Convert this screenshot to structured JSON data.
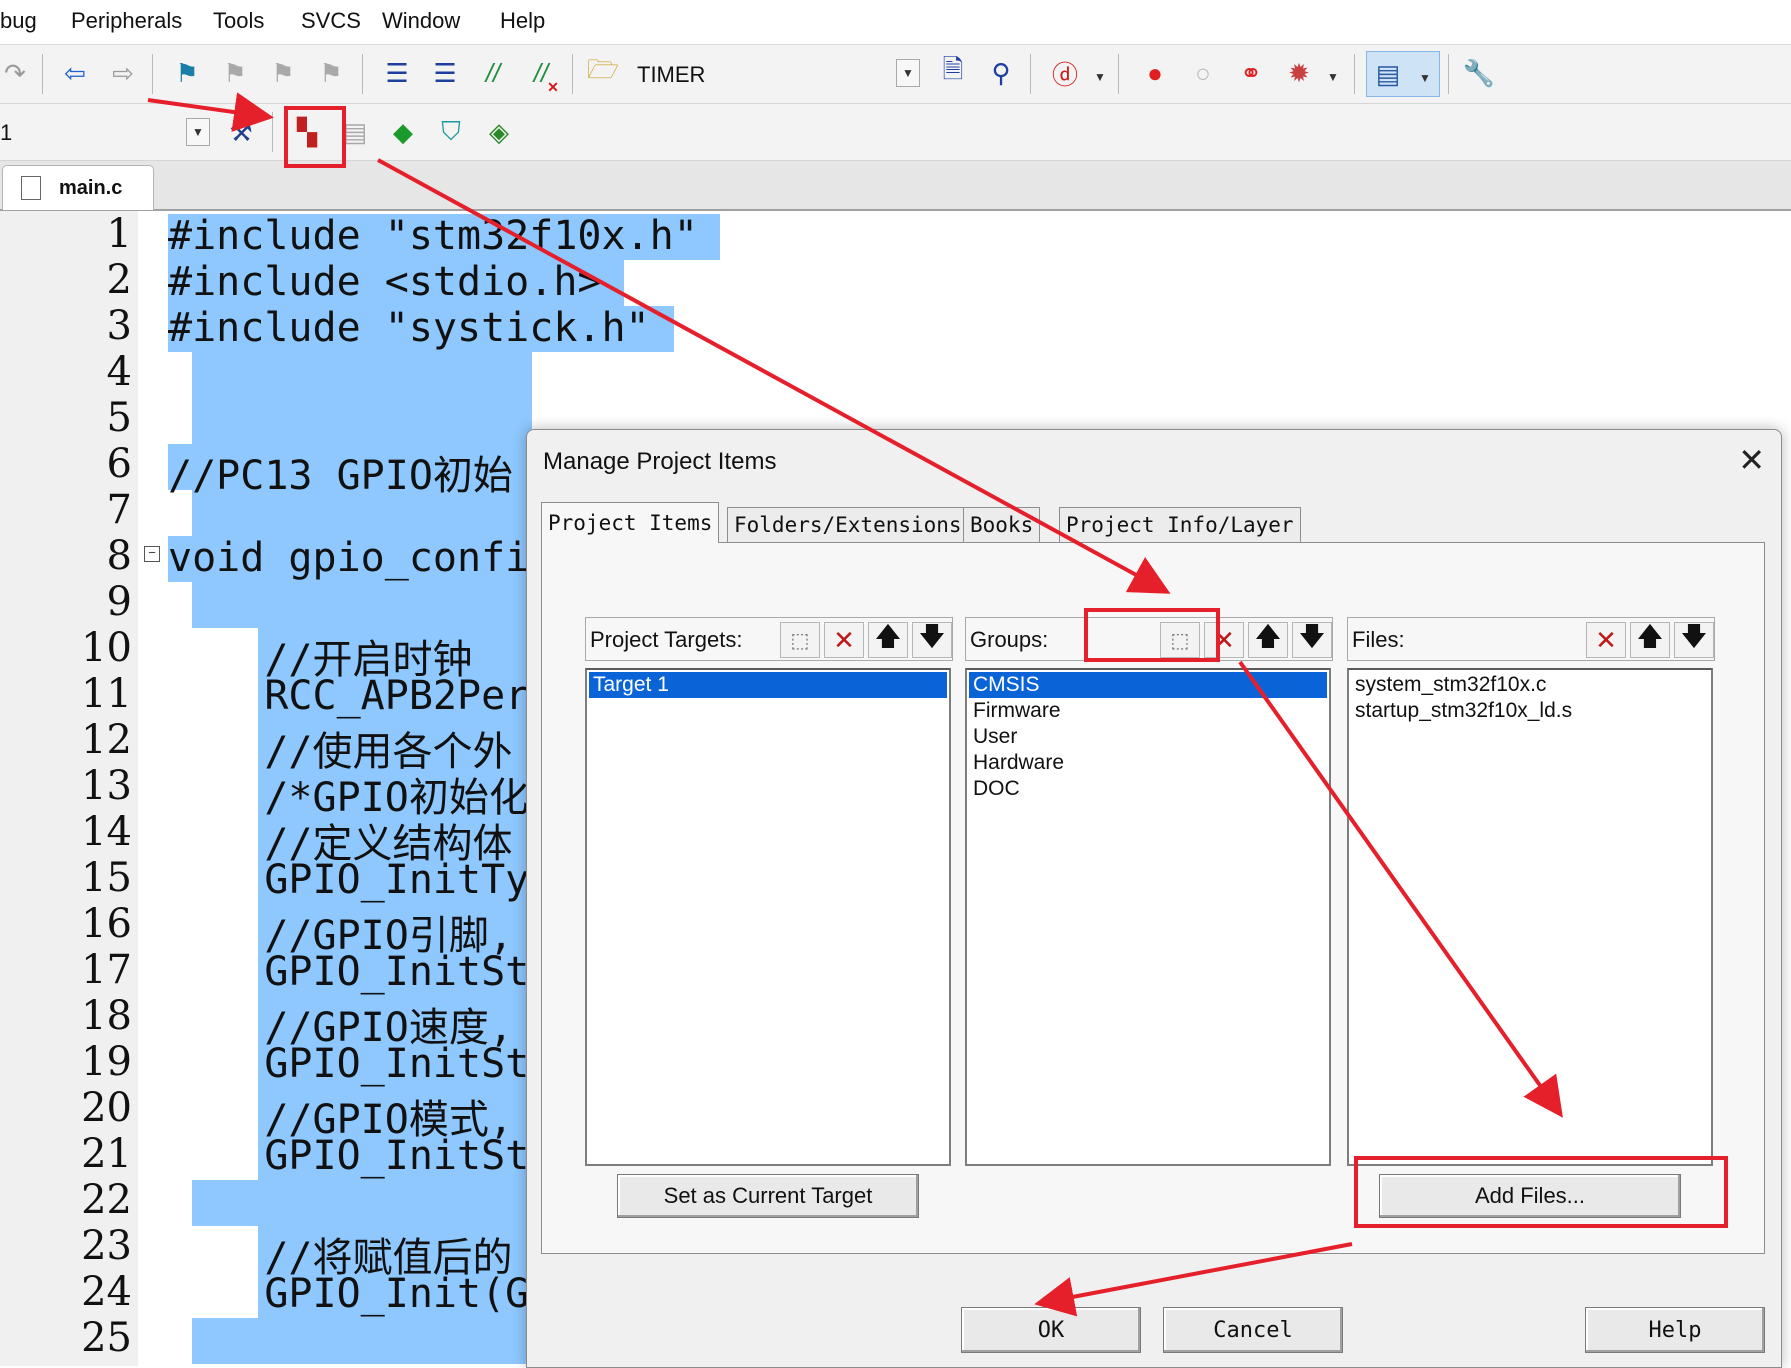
{
  "menubar": {
    "items": [
      "bug",
      "Peripherals",
      "Tools",
      "SVCS",
      "Window",
      "Help"
    ]
  },
  "toolbar1": {
    "target_name": "TIMER",
    "icons": [
      "redo-icon",
      "back-arrow-icon",
      "forward-arrow-icon",
      "bookmark-set-icon",
      "bookmark-prev-icon",
      "bookmark-next-icon",
      "bookmark-clear-icon",
      "indent-icon",
      "unindent-icon",
      "comment-icon",
      "uncomment-icon",
      "open-folder-icon",
      "find-in-files-icon",
      "find-icon",
      "debug-session-icon",
      "breakpoint-icon",
      "breakpoint-disable-icon",
      "kill-breakpoints-icon",
      "disable-all-breakpoints-icon",
      "window-layout-icon",
      "configure-icon"
    ]
  },
  "toolbar2": {
    "target_combo_value": "1",
    "icons": [
      "build-options-icon",
      "manage-project-items-icon",
      "batch-build-icon",
      "pack-installer-icon",
      "select-packs-icon",
      "manage-runtime-icon"
    ]
  },
  "editor": {
    "tab_label": "main.c",
    "lines": [
      {
        "n": "1",
        "text": "#include \"stm32f10x.h\""
      },
      {
        "n": "2",
        "text": "#include <stdio.h>"
      },
      {
        "n": "3",
        "text": "#include \"systick.h\""
      },
      {
        "n": "4",
        "text": ""
      },
      {
        "n": "5",
        "text": ""
      },
      {
        "n": "6",
        "text": "//PC13 GPIO初始"
      },
      {
        "n": "7",
        "text": ""
      },
      {
        "n": "8",
        "text": "void gpio_confi"
      },
      {
        "n": "9",
        "text": ""
      },
      {
        "n": "10",
        "text": "    //开启时钟"
      },
      {
        "n": "11",
        "text": "    RCC_APB2Per"
      },
      {
        "n": "12",
        "text": "    //使用各个外"
      },
      {
        "n": "13",
        "text": "    /*GPIO初始化"
      },
      {
        "n": "14",
        "text": "    //定义结构体"
      },
      {
        "n": "15",
        "text": "    GPIO_InitTy"
      },
      {
        "n": "16",
        "text": "    //GPIO引脚,"
      },
      {
        "n": "17",
        "text": "    GPIO_InitSt"
      },
      {
        "n": "18",
        "text": "    //GPIO速度,"
      },
      {
        "n": "19",
        "text": "    GPIO_InitSt"
      },
      {
        "n": "20",
        "text": "    //GPIO模式,"
      },
      {
        "n": "21",
        "text": "    GPIO_InitSt"
      },
      {
        "n": "22",
        "text": ""
      },
      {
        "n": "23",
        "text": "    //将赋值后的"
      },
      {
        "n": "24",
        "text": "    GPIO_Init(G"
      },
      {
        "n": "25",
        "text": ""
      }
    ]
  },
  "dialog": {
    "title": "Manage Project Items",
    "tabs": [
      "Project Items",
      "Folders/Extensions",
      "Books",
      "Project Info/Layer"
    ],
    "targets_label": "Project Targets:",
    "groups_label": "Groups:",
    "files_label": "Files:",
    "targets": [
      "Target 1"
    ],
    "groups": [
      "CMSIS",
      "Firmware",
      "User",
      "Hardware",
      "DOC"
    ],
    "files": [
      "system_stm32f10x.c",
      "startup_stm32f10x_ld.s"
    ],
    "set_current_label": "Set as Current Target",
    "add_files_label": "Add Files...",
    "ok_label": "OK",
    "cancel_label": "Cancel",
    "help_label": "Help"
  },
  "colors": {
    "selection_highlight": "#8ec8ff",
    "list_selection": "#0a64d8",
    "annotation_red": "#e5202a"
  }
}
